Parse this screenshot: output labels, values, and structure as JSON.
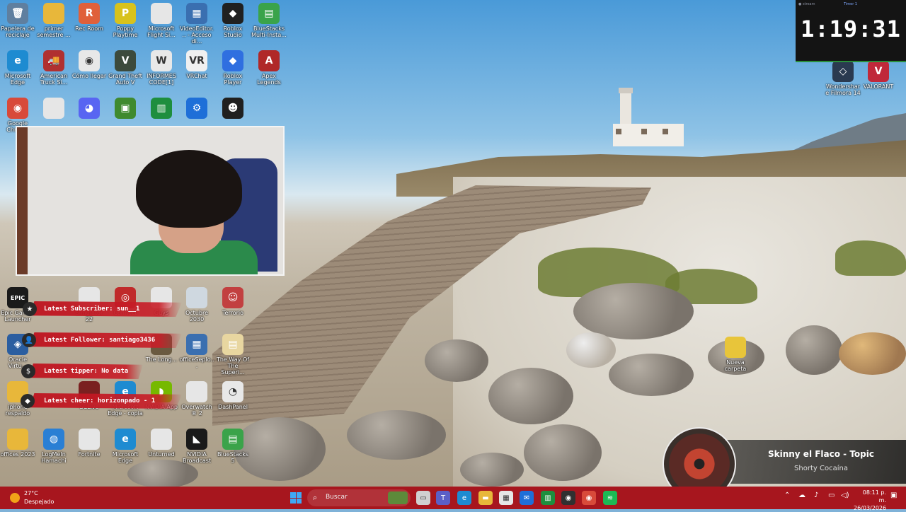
{
  "desktop_icons": [
    {
      "label": "Papelera de reciclaje",
      "icon": "recycle-bin-icon",
      "color": "#5f7f9f",
      "glyph": "🗑"
    },
    {
      "label": "primer semestre ...",
      "icon": "folder-icon",
      "color": "#e8b73a",
      "glyph": ""
    },
    {
      "label": "Rec Room",
      "icon": "rec-room-icon",
      "color": "#e0603a",
      "glyph": "R"
    },
    {
      "label": "Poppy Playtime",
      "icon": "poppy-playtime-icon",
      "color": "#d8c21c",
      "glyph": "P"
    },
    {
      "label": "Microsoft Flight Si...",
      "icon": "file-icon",
      "color": "#e6e6e6",
      "glyph": ""
    },
    {
      "label": "VideoEditor... - Acceso di...",
      "icon": "video-editor-icon",
      "color": "#3a6fb0",
      "glyph": "▦"
    },
    {
      "label": "Roblox Studio",
      "icon": "roblox-studio-icon",
      "color": "#202020",
      "glyph": "◆"
    },
    {
      "label": "BlueStacks Multi-Insta...",
      "icon": "bluestacks-icon",
      "color": "#3aa34a",
      "glyph": "▤"
    },
    {
      "label": "Microsoft Edge",
      "icon": "edge-icon",
      "color": "#1e8bd1",
      "glyph": "e"
    },
    {
      "label": "American Truck Si...",
      "icon": "american-truck-icon",
      "color": "#b03030",
      "glyph": "🚚"
    },
    {
      "label": "Cómo llegar",
      "icon": "chrome-icon",
      "color": "#e8e8e8",
      "glyph": "◉"
    },
    {
      "label": "Grand Theft Auto V",
      "icon": "gta-v-icon",
      "color": "#3c4a3c",
      "glyph": "V"
    },
    {
      "label": "INFORMES CODE[1]",
      "icon": "word-document-icon",
      "color": "#e8e8e8",
      "glyph": "W"
    },
    {
      "label": "VRChat",
      "icon": "vrchat-icon",
      "color": "#f0f0f0",
      "glyph": "VR"
    },
    {
      "label": "Roblox Player",
      "icon": "roblox-player-icon",
      "color": "#2f6fe0",
      "glyph": "◆"
    },
    {
      "label": "Apex Legends",
      "icon": "apex-legends-icon",
      "color": "#b02828",
      "glyph": "A"
    },
    {
      "label": "Google Chrome",
      "icon": "chrome-icon",
      "color": "#d84a3a",
      "glyph": "◉"
    },
    {
      "label": "",
      "icon": "file-icon",
      "color": "#e6e6e6",
      "glyph": ""
    },
    {
      "label": "",
      "icon": "discord-icon",
      "color": "#5865f2",
      "glyph": "◕"
    },
    {
      "label": "",
      "icon": "minecraft-icon",
      "color": "#3f8a2f",
      "glyph": "▣"
    },
    {
      "label": "",
      "icon": "classroom-icon",
      "color": "#1e8e3e",
      "glyph": "▥"
    },
    {
      "label": "",
      "icon": "settings-app-icon",
      "color": "#1e6fd8",
      "glyph": "⚙"
    },
    {
      "label": "",
      "icon": "game-icon",
      "color": "#202020",
      "glyph": "☻"
    },
    {
      "label": "Epic Games Launcher",
      "icon": "epic-games-icon",
      "color": "#1a1a1a",
      "glyph": "EPIC"
    },
    {
      "label": "Simulator 22",
      "icon": "simulator-icon",
      "color": "#e6e6e6",
      "glyph": ""
    },
    {
      "label": "Connect",
      "icon": "connect-icon",
      "color": "#c02a2a",
      "glyph": "◎"
    },
    {
      "label": "Guys",
      "icon": "file-icon",
      "color": "#e6e6e6",
      "glyph": ""
    },
    {
      "label": "Octubre 2030",
      "icon": "image-icon",
      "color": "#cfd8e0",
      "glyph": ""
    },
    {
      "label": "Terrorio",
      "icon": "avatar-icon",
      "color": "#c24040",
      "glyph": "☺"
    },
    {
      "label": "Oracle Virtu...",
      "icon": "virtualbox-icon",
      "color": "#2b5ea0",
      "glyph": "◈"
    },
    {
      "label": "The Long...",
      "icon": "game-icon",
      "color": "#6a5a40",
      "glyph": ""
    },
    {
      "label": "officeSeplo...",
      "icon": "video-editor-icon",
      "color": "#3a6fb0",
      "glyph": "▦"
    },
    {
      "label": "The Way Of The Superi...",
      "icon": "book-icon",
      "color": "#e8d6a0",
      "glyph": "▤"
    },
    {
      "label": "iphone respaldo",
      "icon": "folder-icon",
      "color": "#e8b73a",
      "glyph": ""
    },
    {
      "label": "SCLive",
      "icon": "game-icon",
      "color": "#7a2020",
      "glyph": ""
    },
    {
      "label": "Microsoft Edge - copia",
      "icon": "edge-icon",
      "color": "#1e8bd1",
      "glyph": "e"
    },
    {
      "label": "NVIDIA App",
      "icon": "nvidia-icon",
      "color": "#76b900",
      "glyph": "◗"
    },
    {
      "label": "Overwatch® 2",
      "icon": "file-icon",
      "color": "#e6e6e6",
      "glyph": ""
    },
    {
      "label": "DashPanel",
      "icon": "dashpanel-icon",
      "color": "#e8e8e8",
      "glyph": "◔"
    },
    {
      "label": "offices 2023",
      "icon": "folder-icon",
      "color": "#e8b73a",
      "glyph": ""
    },
    {
      "label": "LogMeIn Hamachi",
      "icon": "hamachi-icon",
      "color": "#2a7fd4",
      "glyph": "◍"
    },
    {
      "label": "Fortnite",
      "icon": "file-icon",
      "color": "#e6e6e6",
      "glyph": ""
    },
    {
      "label": "Microsoft Edge",
      "icon": "edge-icon",
      "color": "#1e8bd1",
      "glyph": "e"
    },
    {
      "label": "Unturned",
      "icon": "file-icon",
      "color": "#e6e6e6",
      "glyph": ""
    },
    {
      "label": "NVIDIA Broadcast",
      "icon": "nvidia-broadcast-icon",
      "color": "#1a1a1a",
      "glyph": "◣"
    },
    {
      "label": "BlueStacks 5",
      "icon": "bluestacks-icon",
      "color": "#3aa34a",
      "glyph": "▤"
    },
    {
      "label": "Wondershare Filmora 14",
      "icon": "filmora-icon",
      "color": "#2a3a50",
      "glyph": "◇"
    },
    {
      "label": "VALORANT",
      "icon": "valorant-icon",
      "color": "#c0283a",
      "glyph": "V"
    },
    {
      "label": "Nueva carpeta",
      "icon": "folder-icon",
      "color": "#e8c53a",
      "glyph": ""
    }
  ],
  "timer": {
    "brand": "● stream",
    "title": "Timer 1",
    "value": "1:19:31"
  },
  "alerts": [
    {
      "icon": "star-icon",
      "glyph": "★",
      "text": "Latest Subscriber: sun__1"
    },
    {
      "icon": "user-icon",
      "glyph": "👤",
      "text": "Latest Follower: santiago3436"
    },
    {
      "icon": "dollar-icon",
      "glyph": "$",
      "text": "Latest tipper: No data"
    },
    {
      "icon": "diamond-icon",
      "glyph": "◆",
      "text": "Latest cheer: horizonpado - 1"
    }
  ],
  "now_playing": {
    "artist": "Skinny el Flaco - Topic",
    "title": "Shorty Cocaína"
  },
  "taskbar": {
    "weather_temp": "27°C",
    "weather_condition": "Despejado",
    "search_placeholder": "Buscar",
    "time": "08:11 p. m.",
    "date": "26/03/2026",
    "apps": [
      {
        "icon": "task-view-icon",
        "color": "#d0d0d0",
        "glyph": "▭"
      },
      {
        "icon": "teams-icon",
        "color": "#5b5fc7",
        "glyph": "T"
      },
      {
        "icon": "edge-icon",
        "color": "#1e8bd1",
        "glyph": "e"
      },
      {
        "icon": "file-explorer-icon",
        "color": "#e8b73a",
        "glyph": "▬"
      },
      {
        "icon": "store-icon",
        "color": "#e6e6e6",
        "glyph": "▦"
      },
      {
        "icon": "mail-icon",
        "color": "#1e6fd8",
        "glyph": "✉"
      },
      {
        "icon": "classroom-icon",
        "color": "#1e8e3e",
        "glyph": "▥"
      },
      {
        "icon": "obs-icon",
        "color": "#303030",
        "glyph": "◉"
      },
      {
        "icon": "chrome-icon",
        "color": "#d84a3a",
        "glyph": "◉"
      },
      {
        "icon": "spotify-icon",
        "color": "#1db954",
        "glyph": "≋"
      }
    ]
  }
}
